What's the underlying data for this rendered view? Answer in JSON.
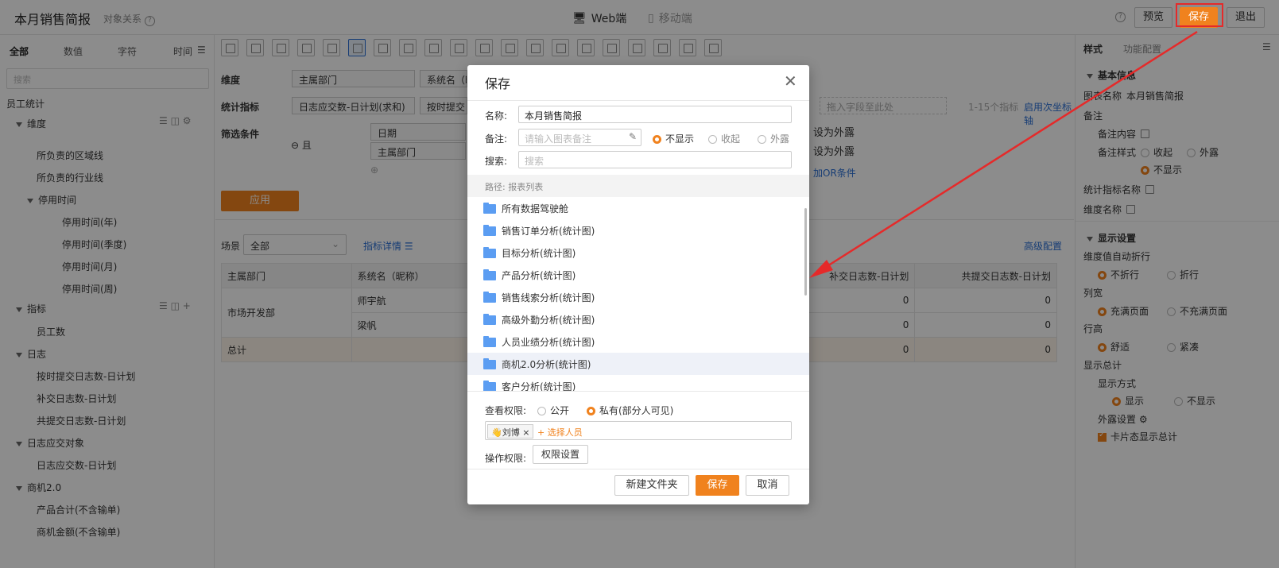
{
  "header": {
    "title": "本月销售简报",
    "object_relation": "对象关系",
    "view_web": "Web端",
    "view_mobile": "移动端",
    "preview": "预览",
    "save": "保存",
    "exit": "退出"
  },
  "left": {
    "tabs": [
      "全部",
      "数值",
      "字符",
      "时间"
    ],
    "search_placeholder": "搜索",
    "root": "员工统计",
    "dimension_label": "维度",
    "dimension_items": [
      "所负责的区域线",
      "所负责的行业线"
    ],
    "stop_time": "停用时间",
    "stop_time_items": [
      "停用时间(年)",
      "停用时间(季度)",
      "停用时间(月)",
      "停用时间(周)"
    ],
    "metric_label": "指标",
    "metric_items": [
      {
        "label": "员工数",
        "level": 1
      },
      {
        "label": "日志",
        "level": 0
      },
      {
        "label": "按时提交日志数-日计划",
        "level": 1
      },
      {
        "label": "补交日志数-日计划",
        "level": 1
      },
      {
        "label": "共提交日志数-日计划",
        "level": 1
      },
      {
        "label": "日志应交对象",
        "level": 0
      },
      {
        "label": "日志应交数-日计划",
        "level": 1
      },
      {
        "label": "商机2.0",
        "level": 0
      },
      {
        "label": "产品合计(不含输单)",
        "level": 1
      },
      {
        "label": "商机金额(不含输单)",
        "level": 1
      }
    ]
  },
  "main": {
    "dimension": "维度",
    "dim_chips": [
      "主属部门",
      "系统名（昵"
    ],
    "metric": "统计指标",
    "metric_chips": [
      "日志应交数-日计划(求和)",
      "按时提交日"
    ],
    "metric_drop": "拖入字段至此处",
    "metric_range": "1-15个指标",
    "secondary_axis": "启用次坐标轴",
    "filter": "筛选条件",
    "and": "且",
    "filter_items": [
      "日期",
      "主属部门"
    ],
    "expose_1": "设为外露",
    "expose_2": "设为外露",
    "add_or": "加OR条件",
    "apply": "应用",
    "scene_label": "场景",
    "scene_value": "全部",
    "metric_detail": "指标详情",
    "advanced": "高级配置",
    "table": {
      "headers": [
        "主属部门",
        "系统名（昵称）",
        "补交日志数-日计划",
        "共提交日志数-日计划"
      ],
      "dept": "市场开发部",
      "rows": [
        {
          "name": "师宇航",
          "c1": "0",
          "c2": "0"
        },
        {
          "name": "梁帆",
          "c1": "0",
          "c2": "0"
        }
      ],
      "total_label": "总计",
      "total": {
        "c1": "0",
        "c2": "0"
      }
    }
  },
  "right": {
    "tabs": [
      "样式",
      "功能配置"
    ],
    "basic_info": "基本信息",
    "chart_name_label": "图表名称",
    "chart_name": "本月销售简报",
    "remark": "备注",
    "remark_content": "备注内容",
    "remark_style": "备注样式",
    "collapse": "收起",
    "expose": "外露",
    "not_show": "不显示",
    "metric_name": "统计指标名称",
    "dim_name": "维度名称",
    "display_settings": "显示设置",
    "auto_wrap": "维度值自动折行",
    "no_wrap": "不折行",
    "wrap": "折行",
    "col_width": "列宽",
    "fill_page": "充满页面",
    "not_fill": "不充满页面",
    "row_height": "行高",
    "comfort": "舒适",
    "compact": "紧凑",
    "show_total": "显示总计",
    "show_mode": "显示方式",
    "show": "显示",
    "hide": "不显示",
    "expose_setting": "外露设置",
    "card_total": "卡片态显示总计"
  },
  "modal": {
    "title": "保存",
    "name_label": "名称:",
    "name_value": "本月销售简报",
    "remark_label": "备注:",
    "remark_placeholder": "请输入图表备注",
    "remark_options": [
      "不显示",
      "收起",
      "外露"
    ],
    "search_label": "搜索:",
    "search_placeholder": "搜索",
    "path": "路径:  报表列表",
    "folders": [
      "所有数据驾驶舱",
      "销售订单分析(统计图)",
      "目标分析(统计图)",
      "产品分析(统计图)",
      "销售线索分析(统计图)",
      "高级外勤分析(统计图)",
      "人员业绩分析(统计图)",
      "商机2.0分析(统计图)",
      "客户分析(统计图)"
    ],
    "view_perm_label": "查看权限:",
    "public": "公开",
    "private": "私有(部分人可见)",
    "tag_person": "刘博",
    "select_person": "+ 选择人员",
    "op_perm_label": "操作权限:",
    "perm_setting": "权限设置",
    "new_folder": "新建文件夹",
    "save": "保存",
    "cancel": "取消"
  },
  "colors": {
    "accent": "#f0821e",
    "link": "#2a6fd6",
    "annotation": "#e52a2a"
  }
}
